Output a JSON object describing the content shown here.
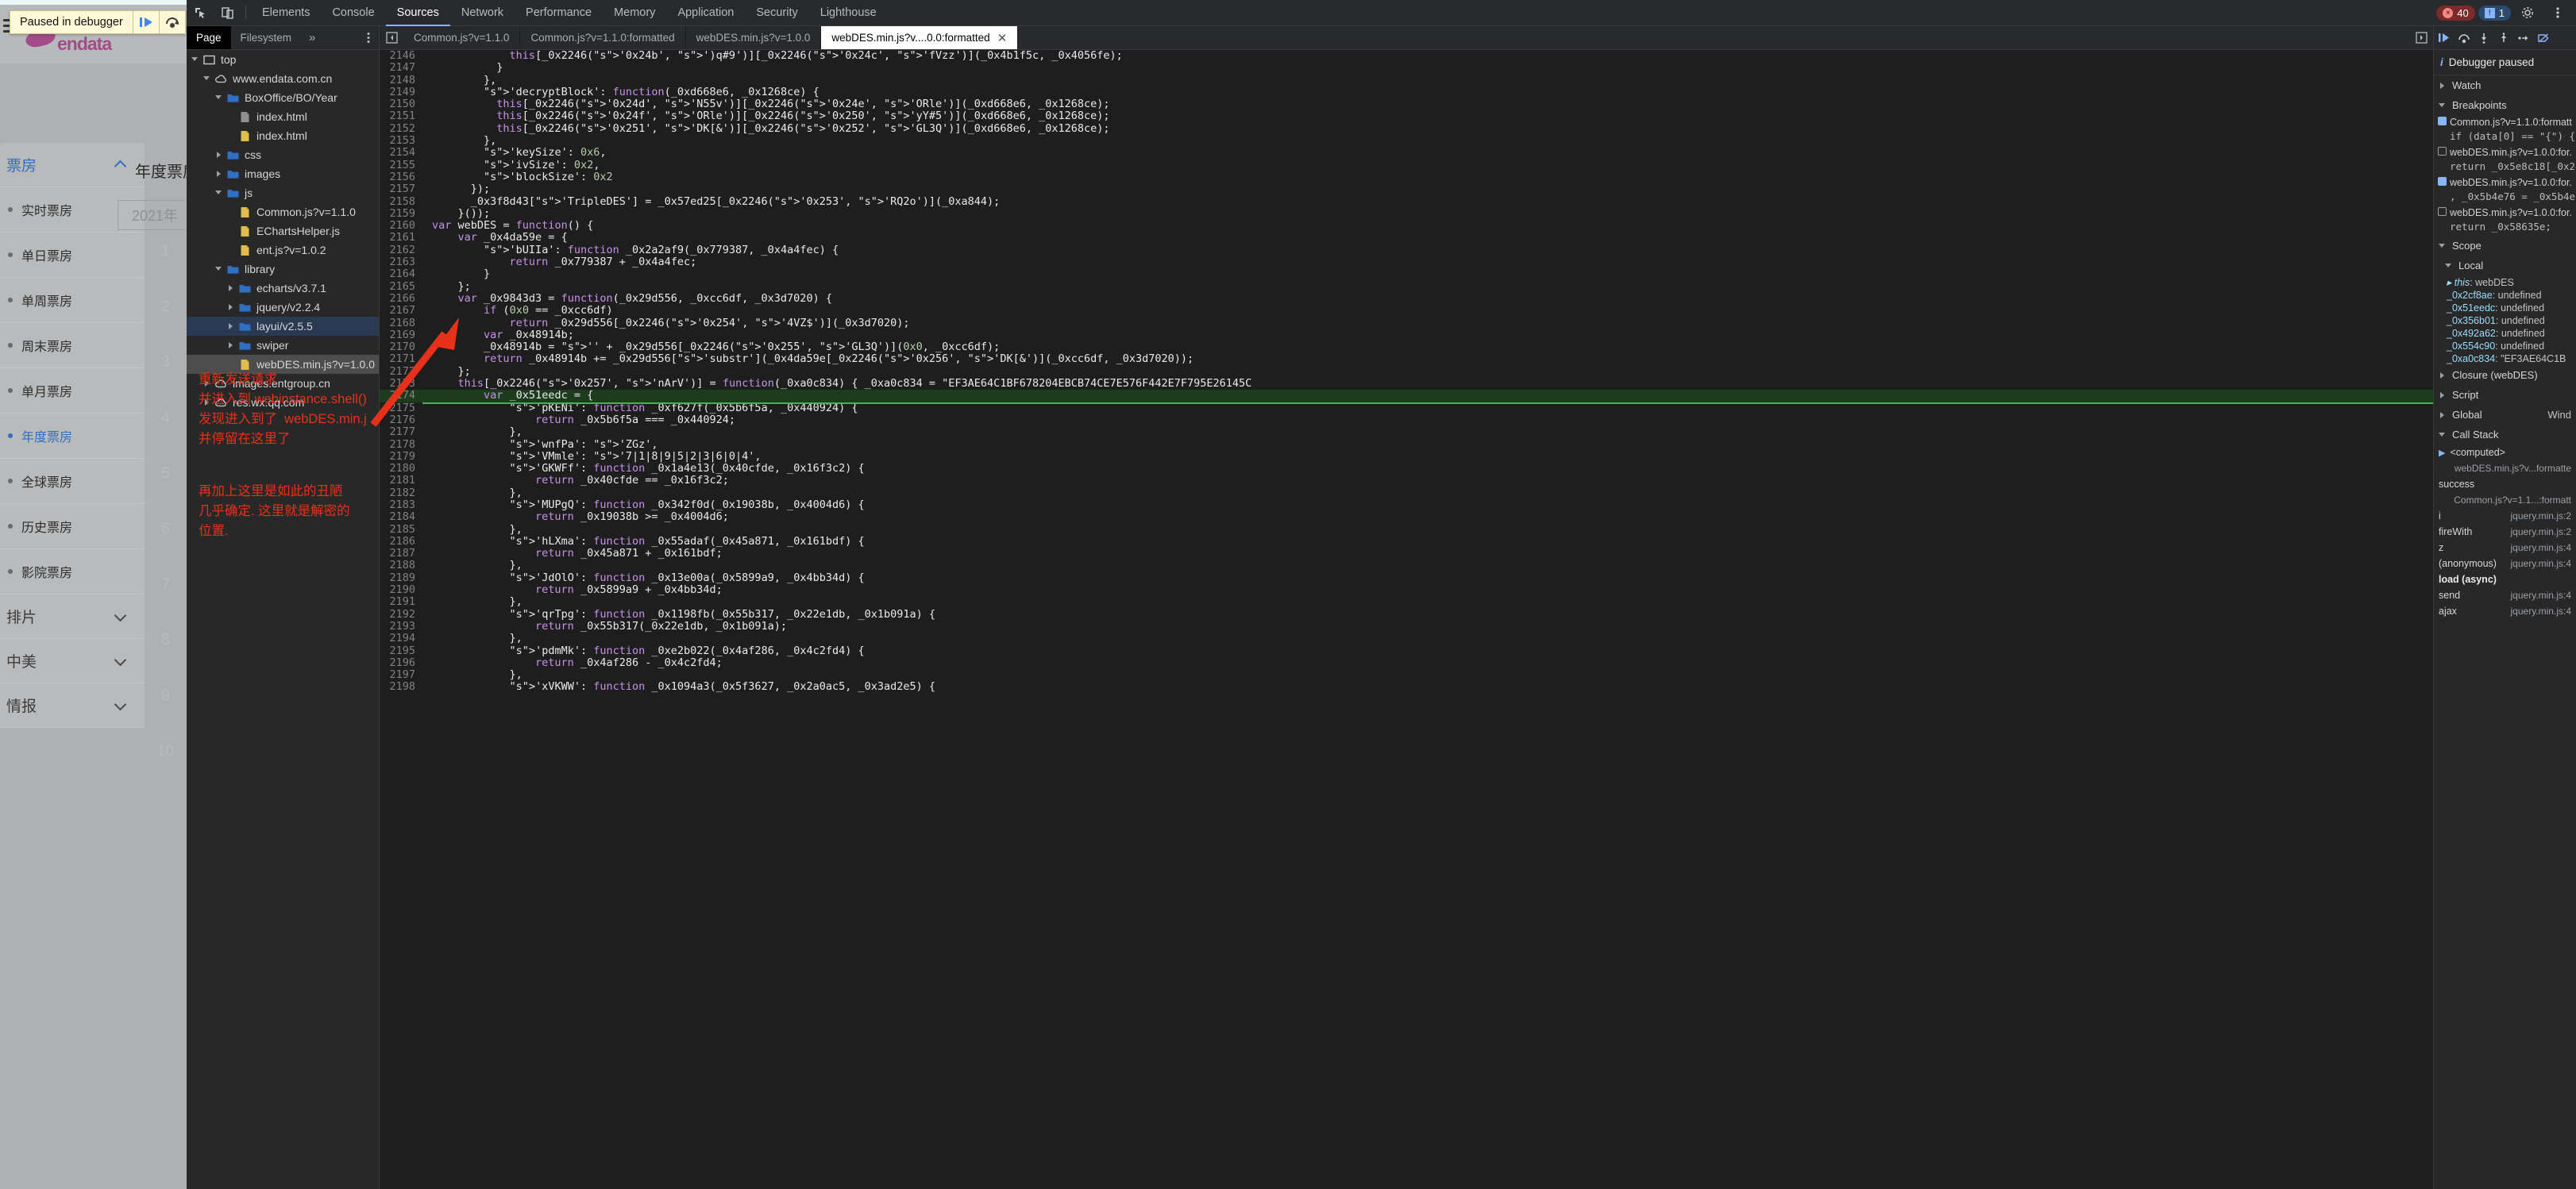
{
  "page": {
    "brand": "endata",
    "paused_bar": {
      "label": "Paused in debugger",
      "resume_icon": "resume-script-icon",
      "step_over_icon": "step-over-icon",
      "menu_icon": "hamburger-icon"
    },
    "menu": {
      "groups": [
        {
          "label": "票房",
          "expanded": true,
          "chevron": "chevron-up-icon",
          "items": [
            {
              "label": "实时票房",
              "active": false
            },
            {
              "label": "单日票房",
              "active": false
            },
            {
              "label": "单周票房",
              "active": false
            },
            {
              "label": "周末票房",
              "active": false
            },
            {
              "label": "单月票房",
              "active": false
            },
            {
              "label": "年度票房",
              "active": true
            },
            {
              "label": "全球票房",
              "active": false
            },
            {
              "label": "历史票房",
              "active": false
            },
            {
              "label": "影院票房",
              "active": false
            }
          ]
        },
        {
          "label": "排片",
          "expanded": false,
          "chevron": "chevron-down-icon",
          "items": []
        },
        {
          "label": "中美",
          "expanded": false,
          "chevron": "chevron-down-icon",
          "items": []
        },
        {
          "label": "情报",
          "expanded": false,
          "chevron": "chevron-down-icon",
          "items": []
        }
      ]
    },
    "main": {
      "title": "年度票房",
      "year_select": {
        "value": "2021年",
        "chevron": "chevron-down-icon"
      },
      "rank_numbers": [
        "1",
        "2",
        "3",
        "4",
        "5",
        "6",
        "7",
        "8",
        "9",
        "10"
      ]
    },
    "annotations": [
      "重新发送请求\n并进入到 webinstance.shell()\n发现进入到了  webDES.min.j\n并停留在这里了",
      "再加上这里是如此的丑陋\n几乎确定. 这里就是解密的\n位置."
    ],
    "annotation_color": "#e8311a"
  },
  "devtools": {
    "toolbar": {
      "inspect_icon": "inspect-element-icon",
      "device_icon": "device-toolbar-icon",
      "tabs": [
        {
          "label": "Elements",
          "selected": false
        },
        {
          "label": "Console",
          "selected": false
        },
        {
          "label": "Sources",
          "selected": true
        },
        {
          "label": "Network",
          "selected": false
        },
        {
          "label": "Performance",
          "selected": false
        },
        {
          "label": "Memory",
          "selected": false
        },
        {
          "label": "Application",
          "selected": false
        },
        {
          "label": "Security",
          "selected": false
        },
        {
          "label": "Lighthouse",
          "selected": false
        }
      ],
      "error_count": "40",
      "warning_count": "1",
      "settings_icon": "gear-icon",
      "more_icon": "kebab-menu-icon"
    },
    "navigator": {
      "tabs": [
        {
          "label": "Page",
          "selected": true
        },
        {
          "label": "Filesystem",
          "selected": false
        }
      ],
      "overflow_icon": "chevrons-right-icon",
      "kebab_icon": "kebab-menu-icon",
      "tree": [
        {
          "label": "top",
          "depth": 0,
          "icon": "frame-icon",
          "twisty": "open",
          "state": ""
        },
        {
          "label": "www.endata.com.cn",
          "depth": 1,
          "icon": "cloud-icon",
          "twisty": "open",
          "state": ""
        },
        {
          "label": "BoxOffice/BO/Year",
          "depth": 2,
          "icon": "folder-icon",
          "twisty": "open",
          "state": ""
        },
        {
          "label": "index.html",
          "depth": 3,
          "icon": "doc-gray-icon",
          "twisty": "none",
          "state": ""
        },
        {
          "label": "index.html",
          "depth": 3,
          "icon": "doc-yellow-icon",
          "twisty": "none",
          "state": ""
        },
        {
          "label": "css",
          "depth": 2,
          "icon": "folder-icon",
          "twisty": "closed",
          "state": ""
        },
        {
          "label": "images",
          "depth": 2,
          "icon": "folder-icon",
          "twisty": "closed",
          "state": ""
        },
        {
          "label": "js",
          "depth": 2,
          "icon": "folder-icon",
          "twisty": "open",
          "state": ""
        },
        {
          "label": "Common.js?v=1.1.0",
          "depth": 3,
          "icon": "doc-yellow-icon",
          "twisty": "none",
          "state": ""
        },
        {
          "label": "EChartsHelper.js",
          "depth": 3,
          "icon": "doc-yellow-icon",
          "twisty": "none",
          "state": ""
        },
        {
          "label": "ent.js?v=1.0.2",
          "depth": 3,
          "icon": "doc-yellow-icon",
          "twisty": "none",
          "state": ""
        },
        {
          "label": "library",
          "depth": 2,
          "icon": "folder-icon",
          "twisty": "open",
          "state": ""
        },
        {
          "label": "echarts/v3.7.1",
          "depth": 3,
          "icon": "folder-icon",
          "twisty": "closed",
          "state": ""
        },
        {
          "label": "jquery/v2.2.4",
          "depth": 3,
          "icon": "folder-icon",
          "twisty": "closed",
          "state": ""
        },
        {
          "label": "layui/v2.5.5",
          "depth": 3,
          "icon": "folder-icon",
          "twisty": "closed",
          "state": "sel-blue"
        },
        {
          "label": "swiper",
          "depth": 3,
          "icon": "folder-icon",
          "twisty": "closed",
          "state": ""
        },
        {
          "label": "webDES.min.js?v=1.0.0",
          "depth": 3,
          "icon": "doc-yellow-icon",
          "twisty": "none",
          "state": "sel-gray"
        },
        {
          "label": "images.entgroup.cn",
          "depth": 1,
          "icon": "cloud-icon",
          "twisty": "closed",
          "state": ""
        },
        {
          "label": "res.wx.qq.com",
          "depth": 1,
          "icon": "cloud-icon",
          "twisty": "closed",
          "state": ""
        }
      ]
    },
    "editor": {
      "collapse_icon": "collapse-sidebar-icon",
      "popout_icon": "popout-icon",
      "tabs": [
        {
          "label": "Common.js?v=1.1.0",
          "selected": false,
          "closable": false
        },
        {
          "label": "Common.js?v=1.1.0:formatted",
          "selected": false,
          "closable": false
        },
        {
          "label": "webDES.min.js?v=1.0.0",
          "selected": false,
          "closable": false
        },
        {
          "label": "webDES.min.js?v....0.0:formatted",
          "selected": true,
          "closable": true,
          "close_icon": "close-icon"
        }
      ],
      "first_line_number": 2146,
      "highlighted_line": 2174,
      "lines": [
        "            this[_0x2246('0x24b', ')q#9')][_0x2246('0x24c', 'fVzz')](_0x4b1f5c, _0x4056fe);",
        "          }",
        "        },",
        "        'decryptBlock': function(_0xd668e6, _0x1268ce) {",
        "          this[_0x2246('0x24d', 'N55v')][_0x2246('0x24e', 'ORle')](_0xd668e6, _0x1268ce);",
        "          this[_0x2246('0x24f', 'ORle')][_0x2246('0x250', 'yY#5')](_0xd668e6, _0x1268ce);",
        "          this[_0x2246('0x251', 'DK[&')][_0x2246('0x252', 'GL3Q')](_0xd668e6, _0x1268ce);",
        "        },",
        "        'keySize': 0x6,",
        "        'ivSize': 0x2,",
        "        'blockSize': 0x2",
        "      });",
        "      _0x3f8d43['TripleDES'] = _0x57ed25[_0x2246('0x253', 'RQ2o')](_0xa844);",
        "    }());",
        "var webDES = function() {",
        "    var _0x4da59e = {",
        "        'bUIIa': function _0x2a2af9(_0x779387, _0x4a4fec) {",
        "            return _0x779387 + _0x4a4fec;",
        "        }",
        "    };",
        "    var _0x9843d3 = function(_0x29d556, _0xcc6df, _0x3d7020) {",
        "        if (0x0 == _0xcc6df)",
        "            return _0x29d556[_0x2246('0x254', '4VZ$')](_0x3d7020);",
        "        var _0x48914b;",
        "        _0x48914b = '' + _0x29d556[_0x2246('0x255', 'GL3Q')](0x0, _0xcc6df);",
        "        return _0x48914b += _0x29d556['substr'](_0x4da59e[_0x2246('0x256', 'DK[&')](_0xcc6df, _0x3d7020));",
        "    };",
        "    this[_0x2246('0x257', 'nArV')] = function(_0xa0c834) { _0xa0c834 = \"EF3AE64C1BF678204EBCB74CE7E576F442E7F795E26145C",
        "        var _0x51eedc = {",
        "            'pKENi': function _0xf627f(_0x5b6f5a, _0x440924) {",
        "                return _0x5b6f5a === _0x440924;",
        "            },",
        "            'wnfPa': 'ZGz',",
        "            'VMmle': '7|1|8|9|5|2|3|6|0|4',",
        "            'GKWFf': function _0x1a4e13(_0x40cfde, _0x16f3c2) {",
        "                return _0x40cfde == _0x16f3c2;",
        "            },",
        "            'MUPgQ': function _0x342f0d(_0x19038b, _0x4004d6) {",
        "                return _0x19038b >= _0x4004d6;",
        "            },",
        "            'hLXma': function _0x55adaf(_0x45a871, _0x161bdf) {",
        "                return _0x45a871 + _0x161bdf;",
        "            },",
        "            'JdOlO': function _0x13e00a(_0x5899a9, _0x4bb34d) {",
        "                return _0x5899a9 + _0x4bb34d;",
        "            },",
        "            'qrTpg': function _0x1198fb(_0x55b317, _0x22e1db, _0x1b091a) {",
        "                return _0x55b317(_0x22e1db, _0x1b091a);",
        "            },",
        "            'pdmMk': function _0xe2b022(_0x4af286, _0x4c2fd4) {",
        "                return _0x4af286 - _0x4c2fd4;",
        "            },",
        "            'xVKWW': function _0x1094a3(_0x5f3627, _0x2a0ac5, _0x3ad2e5) {"
      ]
    },
    "debugger": {
      "toolbar_icons": [
        "resume-script-icon",
        "step-over-icon",
        "step-into-icon",
        "step-out-icon",
        "step-icon",
        "deactivate-breakpoints-icon"
      ],
      "paused_label": "Debugger paused",
      "paused_icon": "info-icon",
      "watch": {
        "label": "Watch",
        "twisty": "closed"
      },
      "breakpoints": {
        "label": "Breakpoints",
        "twisty": "open",
        "items": [
          {
            "checked": true,
            "file": "Common.js?v=1.1.0:formatt",
            "code": "if (data[0] == \"{\") {"
          },
          {
            "checked": false,
            "file": "webDES.min.js?v=1.0.0:for.",
            "code": "return _0x5e8c18[_0x24"
          },
          {
            "checked": true,
            "file": "webDES.min.js?v=1.0.0:for.",
            "code": ", _0x5b4e76 = _0x5b4e"
          },
          {
            "checked": false,
            "file": "webDES.min.js?v=1.0.0:for.",
            "code": "return _0x58635e;"
          }
        ]
      },
      "scope": {
        "label": "Scope",
        "twisty": "open",
        "local_label": "Local",
        "rows": [
          {
            "name": "this",
            "value": ": webDES",
            "twisty": "closed",
            "italic": true
          },
          {
            "name": "_0x2cf8ae",
            "value": ": undefined"
          },
          {
            "name": "_0x51eedc",
            "value": ": undefined"
          },
          {
            "name": "_0x356b01",
            "value": ": undefined"
          },
          {
            "name": "_0x492a62",
            "value": ": undefined"
          },
          {
            "name": "_0x554c90",
            "value": ": undefined"
          },
          {
            "name": "_0xa0c834",
            "value": ": \"EF3AE64C1B"
          }
        ],
        "groups": [
          {
            "label": "Closure (webDES)",
            "twisty": "closed"
          },
          {
            "label": "Script",
            "twisty": "closed"
          },
          {
            "label": "Global",
            "twisty": "closed",
            "value": "Wind"
          }
        ]
      },
      "call_stack": {
        "label": "Call Stack",
        "twisty": "open",
        "frames": [
          {
            "name": "<computed>",
            "loc": "",
            "selected": true
          },
          {
            "name": "",
            "loc": "webDES.min.js?v...formatte"
          },
          {
            "name": "success",
            "loc": ""
          },
          {
            "name": "",
            "loc": "Common.js?v=1.1...:formatt"
          },
          {
            "name": "i",
            "loc": "jquery.min.js:2"
          },
          {
            "name": "fireWith",
            "loc": "jquery.min.js:2"
          },
          {
            "name": "z",
            "loc": "jquery.min.js:4"
          },
          {
            "name": "(anonymous)",
            "loc": "jquery.min.js:4"
          },
          {
            "name": "load (async)",
            "loc": "",
            "bold": true
          },
          {
            "name": "send",
            "loc": "jquery.min.js:4"
          },
          {
            "name": "ajax",
            "loc": "jquery.min.js:4"
          }
        ]
      }
    }
  }
}
